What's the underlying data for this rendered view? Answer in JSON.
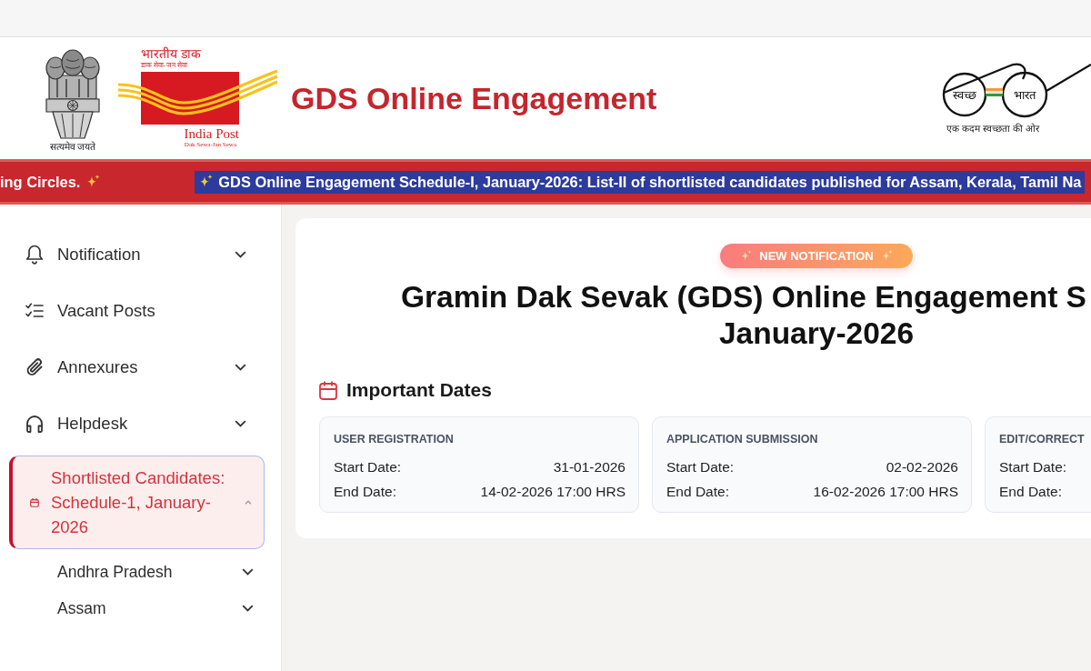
{
  "header": {
    "emblem_motto": "सत्यमेव जयते",
    "post_logo": {
      "hindi_name": "भारतीय डाक",
      "hindi_tagline": "डाक सेवा-जन सेवा",
      "name": "India Post",
      "tagline": "Dak Sewa-Jan Sewa"
    },
    "title": "GDS Online Engagement",
    "swachh_logo": {
      "words": [
        "स्वच्छ",
        "भारत"
      ],
      "tagline": "एक कदम स्वच्छता की ओर"
    }
  },
  "ticker": {
    "items": [
      {
        "text": "ing Circles.",
        "highlighted": false,
        "leading_sparkle": false,
        "trailing_sparkle": true
      },
      {
        "text": "GDS Online Engagement Schedule-I, January-2026: List-II of shortlisted candidates published for Assam, Kerala, Tamil Na",
        "highlighted": true,
        "leading_sparkle": true,
        "trailing_sparkle": false
      }
    ]
  },
  "sidebar": {
    "items": [
      {
        "label": "Notification",
        "kind": "group",
        "expanded": false,
        "selected": false
      },
      {
        "label": "Vacant Posts",
        "kind": "link",
        "selected": false
      },
      {
        "label": "Annexures",
        "kind": "group",
        "expanded": false,
        "selected": false
      },
      {
        "label": "Helpdesk",
        "kind": "group",
        "expanded": false,
        "selected": false
      },
      {
        "label": "Shortlisted Candidates: Schedule-1, January-2026",
        "kind": "group",
        "expanded": true,
        "selected": true,
        "children": [
          {
            "label": "Andhra Pradesh",
            "kind": "group",
            "expanded": false,
            "selected": false
          },
          {
            "label": "Assam",
            "kind": "group",
            "expanded": false,
            "selected": false
          }
        ]
      }
    ]
  },
  "main": {
    "badge": "NEW NOTIFICATION",
    "title_lines": [
      "Gramin Dak Sevak (GDS) Online Engagement S",
      "January-2026"
    ],
    "section_title": "Important Dates",
    "date_cards": [
      {
        "title": "USER REGISTRATION",
        "rows": [
          {
            "label": "Start Date:",
            "value": "31-01-2026"
          },
          {
            "label": "End Date:",
            "value": "14-02-2026 17:00 HRS"
          }
        ]
      },
      {
        "title": "APPLICATION SUBMISSION",
        "rows": [
          {
            "label": "Start Date:",
            "value": "02-02-2026"
          },
          {
            "label": "End Date:",
            "value": "16-02-2026 17:00 HRS"
          }
        ]
      },
      {
        "title": "EDIT/CORRECT",
        "rows": [
          {
            "label": "Start Date:"
          },
          {
            "label": "End Date:"
          }
        ]
      }
    ]
  }
}
